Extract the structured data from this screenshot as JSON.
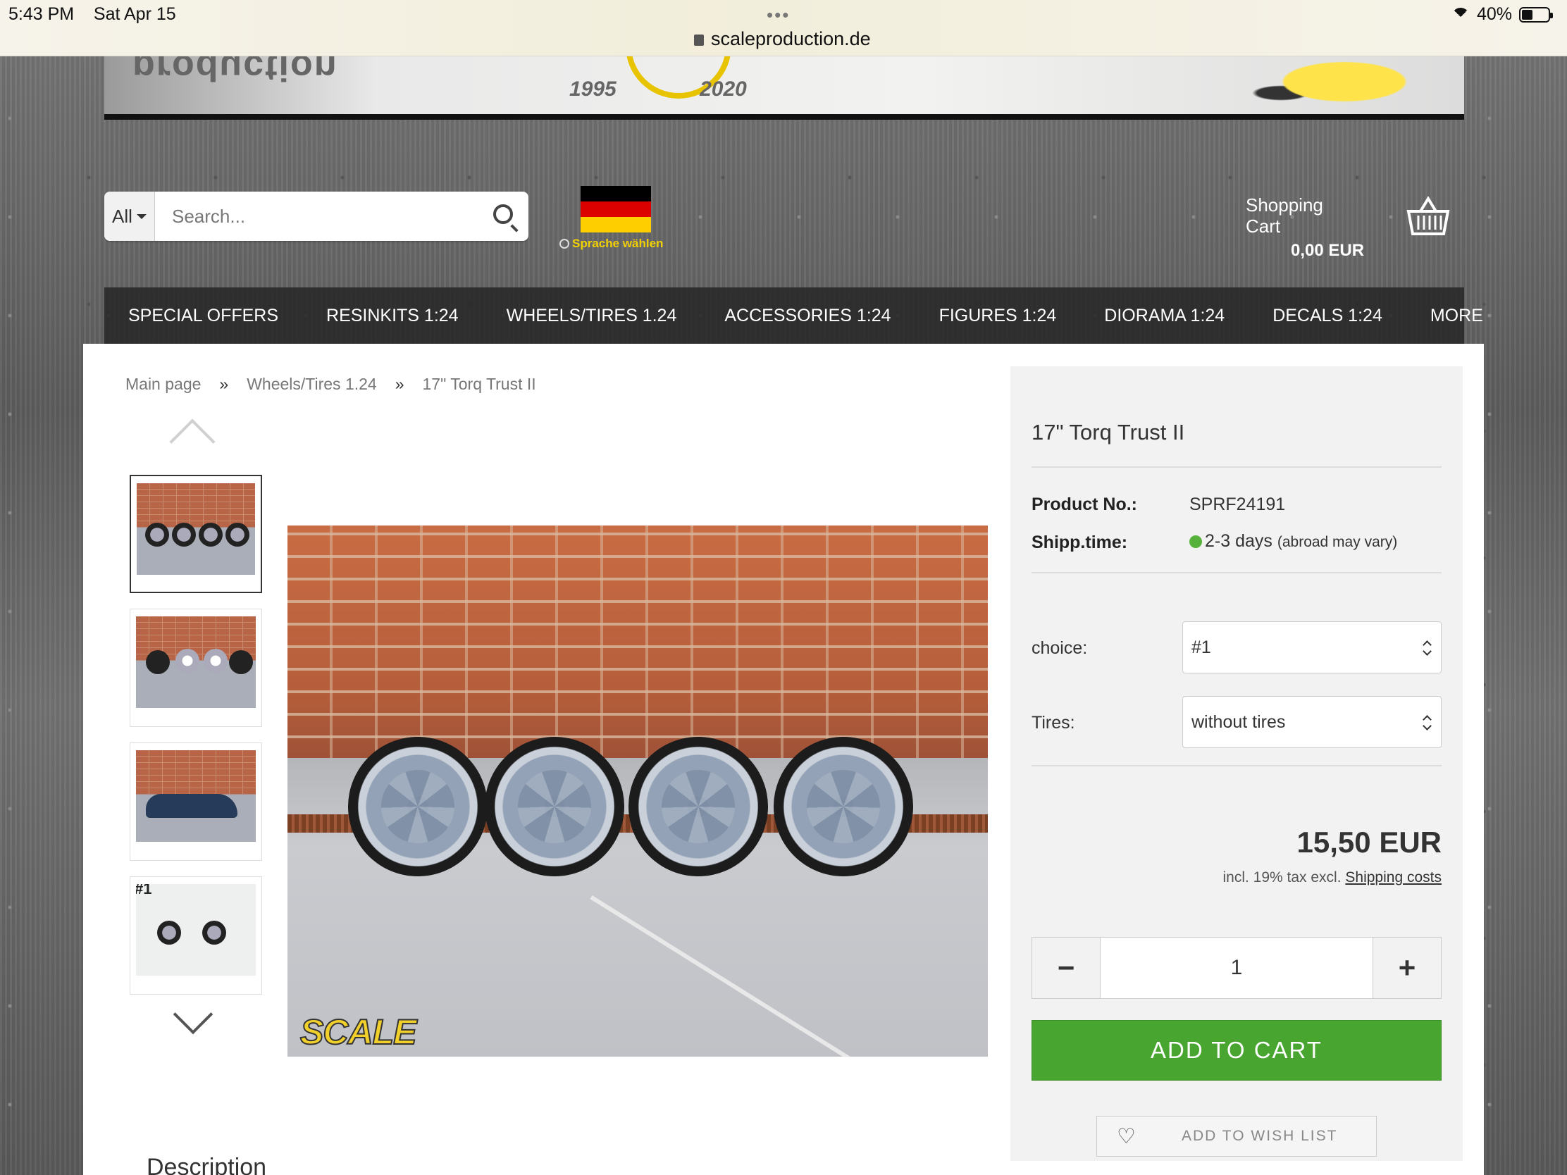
{
  "status": {
    "time": "5:43 PM",
    "date": "Sat Apr 15",
    "url": "scaleproduction.de",
    "battery": "40%"
  },
  "banner": {
    "years": "1995 2020",
    "logo_text": "production"
  },
  "search": {
    "scope": "All",
    "placeholder": "Search..."
  },
  "language": {
    "label": "Sprache wählen"
  },
  "cart": {
    "label": "Shopping Cart",
    "amount": "0,00 EUR"
  },
  "nav": {
    "items": [
      "SPECIAL OFFERS",
      "RESINKITS 1:24",
      "WHEELS/TIRES 1.24",
      "ACCESSORIES 1:24",
      "FIGURES 1:24",
      "DIORAMA 1:24",
      "DECALS 1:24",
      "MORE"
    ]
  },
  "breadcrumb": {
    "items": [
      "Main page",
      "Wheels/Tires 1.24",
      "17\" Torq Trust II"
    ],
    "separator": "»"
  },
  "gallery": {
    "thumb4_tag": "#1",
    "watermark": "SCALE"
  },
  "product": {
    "title": "17\" Torq Trust II",
    "number_label": "Product No.:",
    "number": "SPRF24191",
    "shipping_label": "Shipp.time:",
    "shipping_value": "2-3 days",
    "shipping_note": "(abroad may vary)",
    "choice_label": "choice:",
    "choice_value": "#1",
    "tires_label": "Tires:",
    "tires_value": "without tires",
    "price": "15,50 EUR",
    "tax_text": "incl. 19% tax excl.",
    "shipping_costs": "Shipping costs",
    "quantity": "1",
    "minus": "−",
    "plus": "+",
    "add_to_cart": "ADD TO CART",
    "wish_list": "ADD TO WISH LIST"
  },
  "description": {
    "heading": "Description"
  },
  "colors": {
    "accent_green": "#47a530",
    "availability_green": "#56b23a",
    "nav_bg": "#282828"
  }
}
